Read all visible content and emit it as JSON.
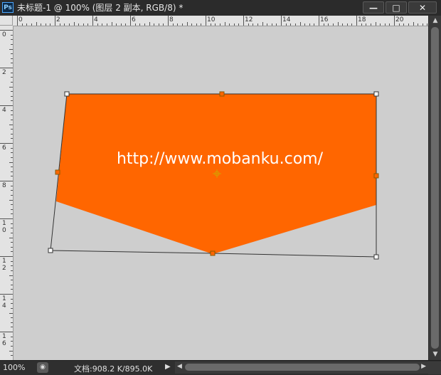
{
  "app": {
    "logo_text": "Ps"
  },
  "window": {
    "title": "未标题-1 @ 100% (图层 2 副本, RGB/8) *",
    "minimize_label": "—",
    "maximize_label": "□",
    "close_label": "✕"
  },
  "rulers": {
    "top_labels": [
      "0",
      "2",
      "4",
      "6",
      "8",
      "10",
      "12",
      "14",
      "16",
      "18",
      "20"
    ],
    "left_labels": [
      "0",
      "2",
      "4",
      "6",
      "8",
      "1\n0",
      "1\n2",
      "1\n4",
      "1\n6"
    ]
  },
  "canvas": {
    "shape_color": "#ff6600",
    "background": "#cecece",
    "text": "http://www.mobanku.com/"
  },
  "statusbar": {
    "zoom": "100%",
    "doc_info": "文档:908.2 K/895.0K",
    "menu_arrow": "▶"
  },
  "scrollbars": {
    "up_arrow": "▲",
    "down_arrow": "▼",
    "left_arrow": "◀",
    "right_arrow": "▶"
  }
}
